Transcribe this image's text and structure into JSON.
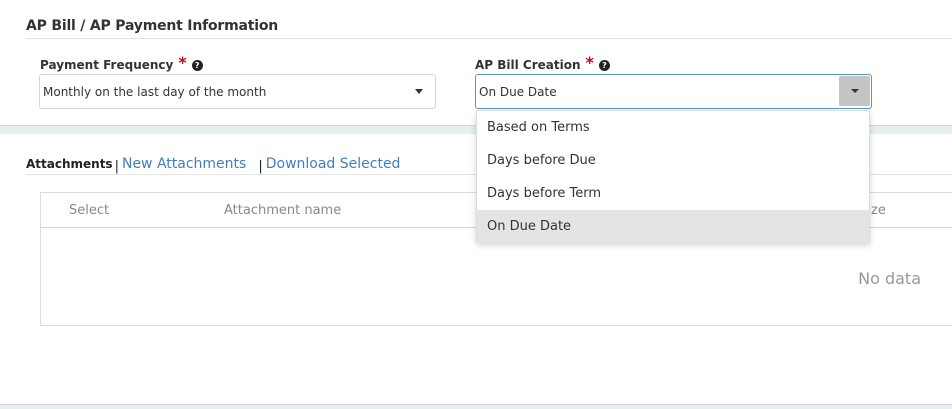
{
  "section": {
    "title": "AP Bill / AP Payment Information"
  },
  "payment_frequency": {
    "label": "Payment Frequency",
    "required_mark": "*",
    "help_icon": "question-circle-icon",
    "value": "Monthly on the last day of the month"
  },
  "ap_bill_creation": {
    "label": "AP Bill Creation",
    "required_mark": "*",
    "help_icon": "question-circle-icon",
    "value": "On Due Date",
    "options": [
      "Based on Terms",
      "Days before Due",
      "Days before Term",
      "On Due Date"
    ],
    "selected_index": 3
  },
  "attachments": {
    "tab_label": "Attachments",
    "separator": "|",
    "new_link": "New Attachments",
    "download_link": "Download Selected",
    "columns": [
      "Select",
      "Attachment name",
      "ze"
    ],
    "empty_text": "No data"
  },
  "colors": {
    "required": "#d0021b",
    "link": "#3f7fbf",
    "focus_border": "#5a93c8",
    "selected_option_bg": "#e4e4e4"
  }
}
